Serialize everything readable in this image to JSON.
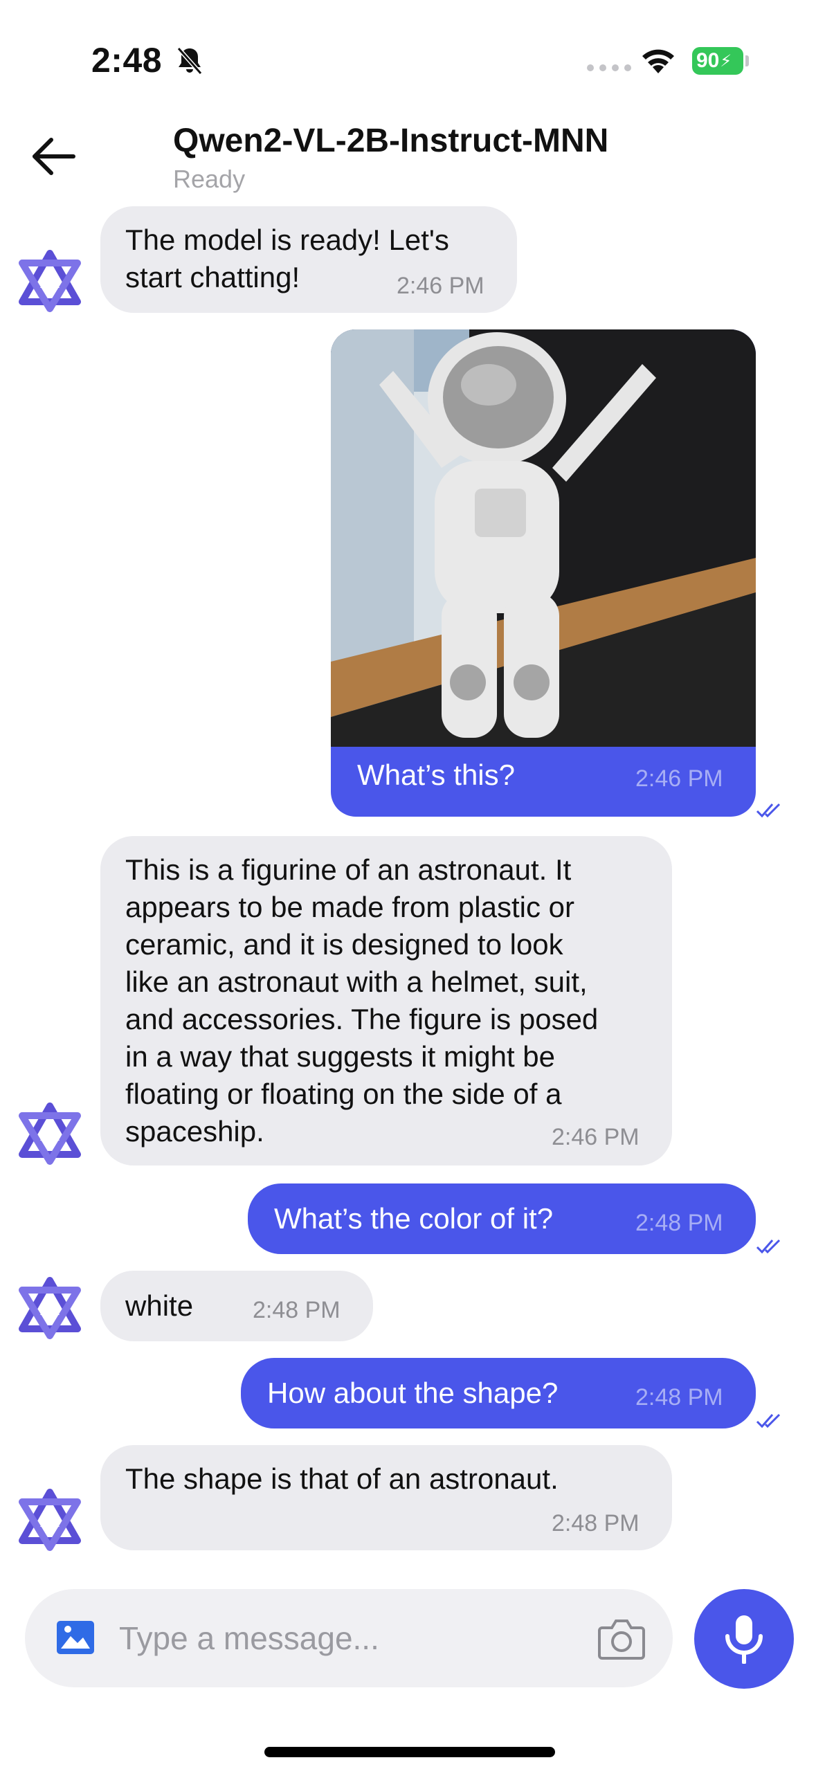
{
  "status_bar": {
    "time": "2:48",
    "battery": "90"
  },
  "header": {
    "title": "Qwen2-VL-2B-Instruct-MNN",
    "subtitle": "Ready"
  },
  "messages": [
    {
      "role": "assistant",
      "lines": [
        "The model is ready! Let's",
        "start chatting!"
      ],
      "time": "2:46 PM"
    },
    {
      "role": "user",
      "has_image": true,
      "image_desc_icon": "astronaut-figurine-photo",
      "text": "What’s this?",
      "time": "2:46 PM"
    },
    {
      "role": "assistant",
      "lines": [
        "This is a figurine of an astronaut. It",
        "appears to be made from plastic or",
        "ceramic, and it is designed to look",
        "like an astronaut with a helmet, suit,",
        "and accessories. The figure is posed",
        "in a way that suggests it might be",
        "floating or floating on the side of a",
        "spaceship."
      ],
      "time": "2:46 PM"
    },
    {
      "role": "user",
      "text": "What’s the color of it?",
      "time": "2:48 PM"
    },
    {
      "role": "assistant",
      "lines": [
        "white"
      ],
      "time": "2:48 PM"
    },
    {
      "role": "user",
      "text": "How about the shape?",
      "time": "2:48 PM"
    },
    {
      "role": "assistant",
      "lines": [
        "The shape is that of an astronaut."
      ],
      "time": "2:48 PM"
    }
  ],
  "input": {
    "placeholder": "Type a message..."
  },
  "icons": {
    "back": "back-arrow-icon",
    "image": "image-icon",
    "camera": "camera-icon",
    "mic": "mic-icon",
    "avatar": "qwen-logo-icon"
  },
  "colors": {
    "accent": "#4a56ea",
    "incoming_bubble": "#ebebef",
    "battery": "#34c759"
  }
}
